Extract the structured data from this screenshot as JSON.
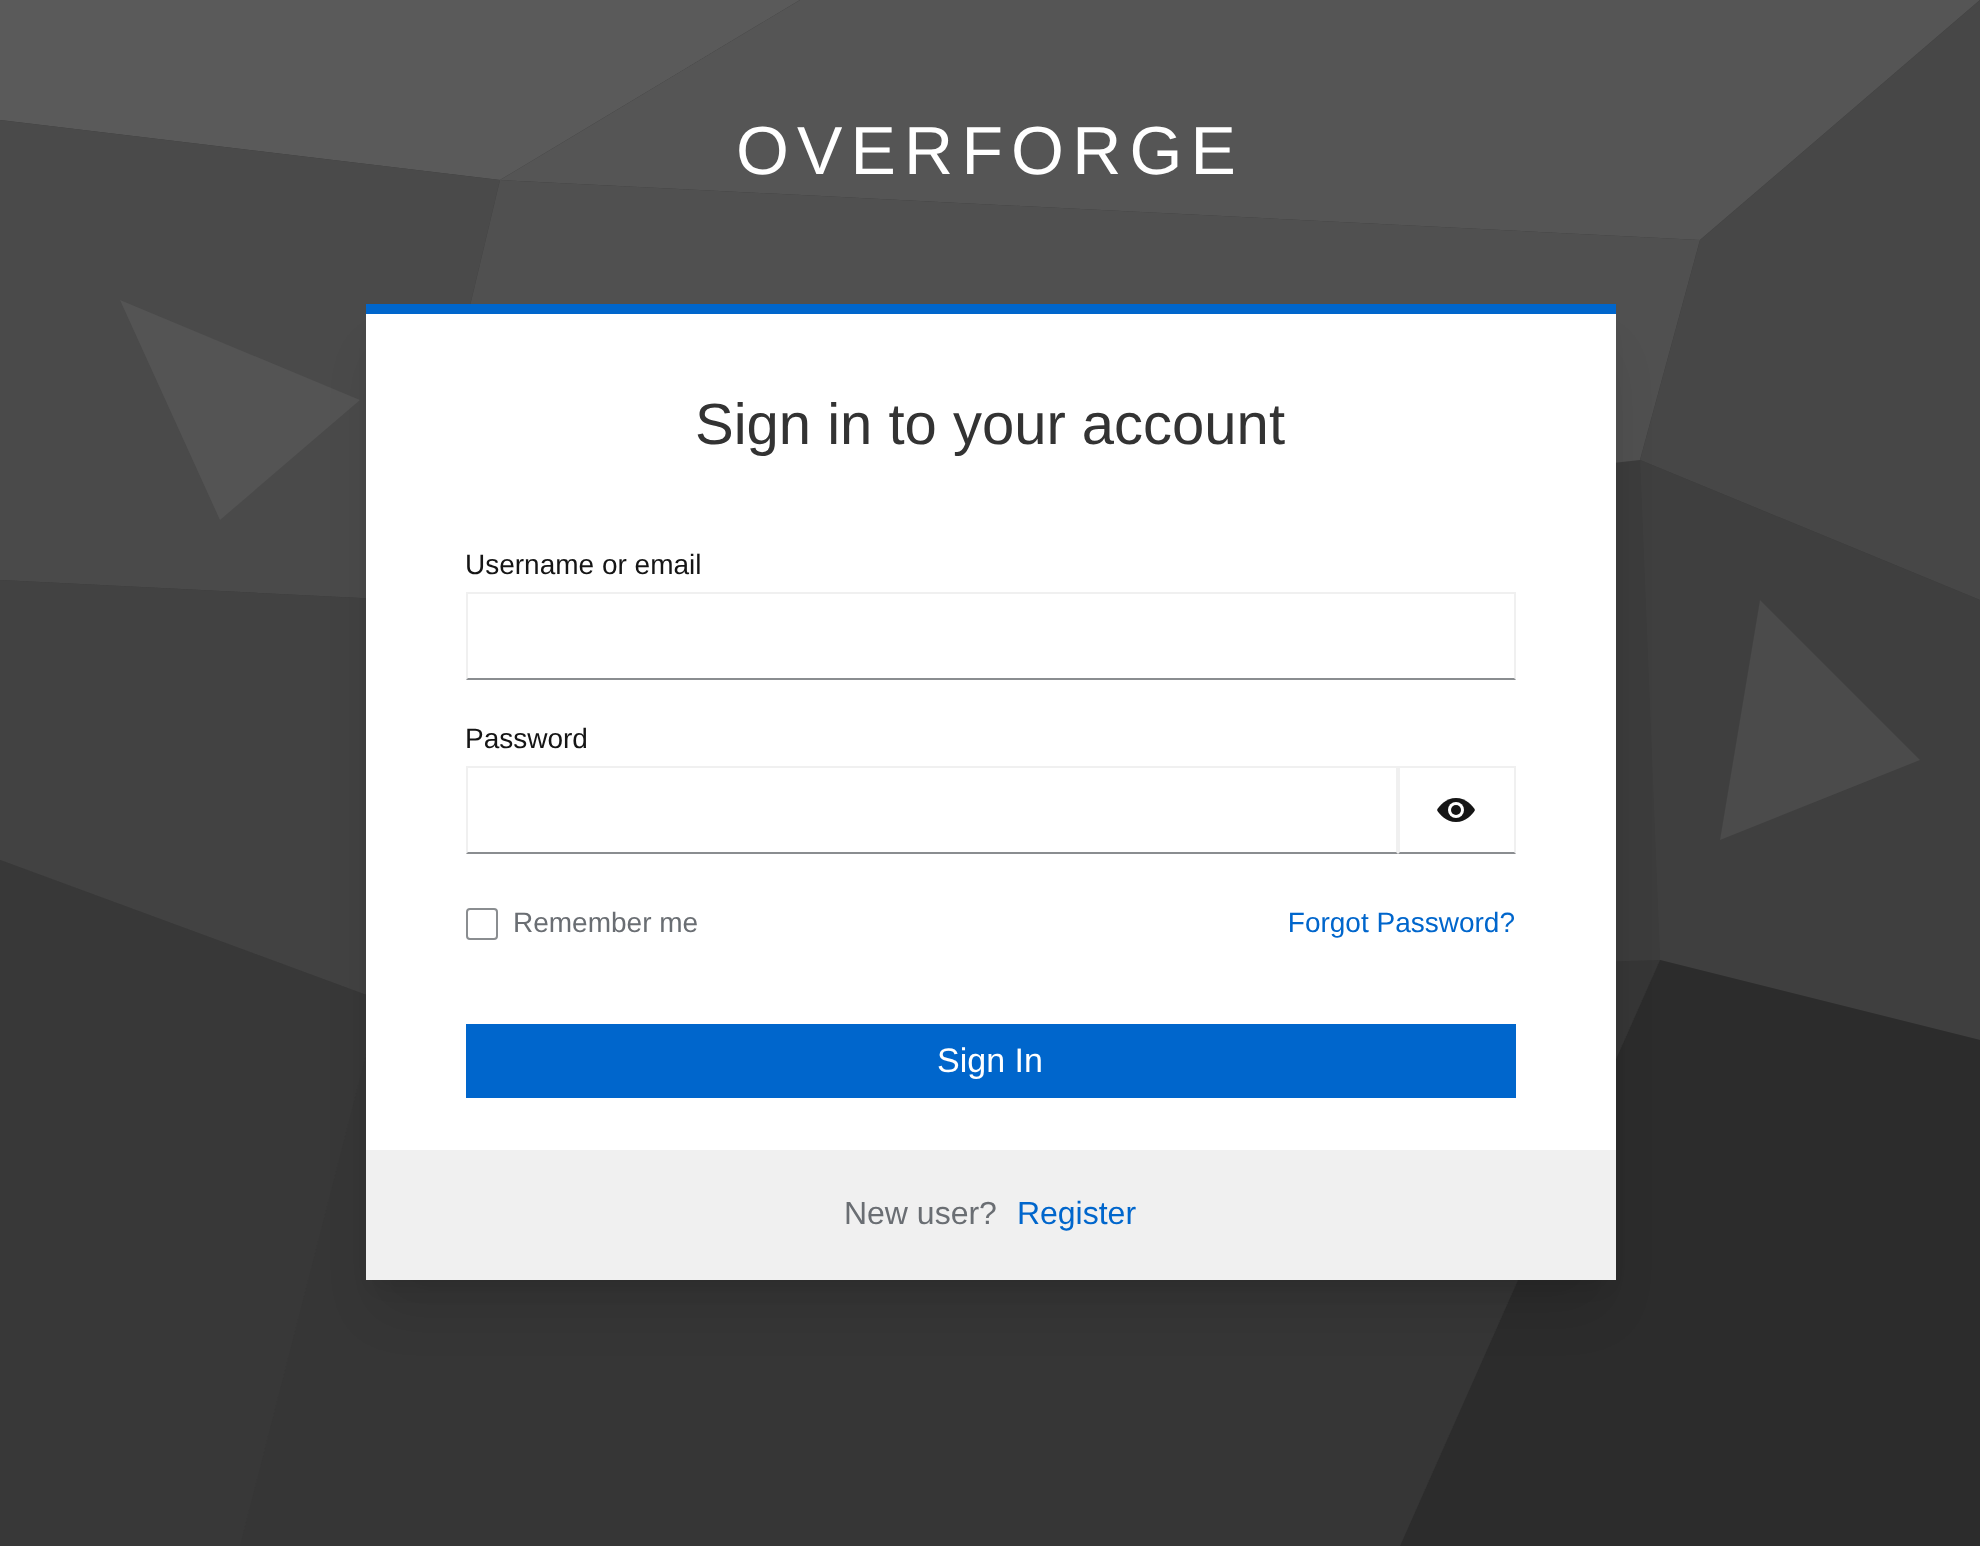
{
  "brand": "OVERFORGE",
  "card": {
    "title": "Sign in to your account",
    "fields": [
      {
        "label": "Username or email",
        "kind": "text"
      },
      {
        "label": "Password",
        "kind": "password"
      }
    ],
    "remember_me": {
      "label": "Remember me",
      "checked": false
    },
    "forgot_link": "Forgot Password?",
    "submit": "Sign In",
    "footer": {
      "text": "New user?",
      "link": "Register"
    }
  }
}
